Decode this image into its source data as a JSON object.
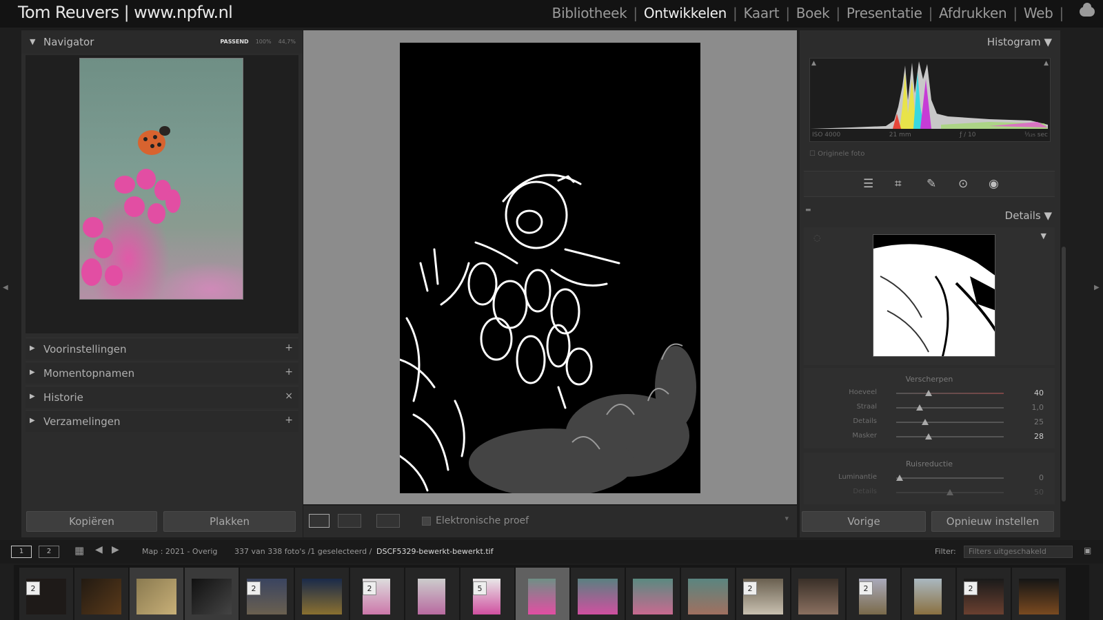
{
  "app": {
    "brand": "Tom Reuvers | www.npfw.nl",
    "modules": [
      {
        "label": "Bibliotheek",
        "active": false
      },
      {
        "label": "Ontwikkelen",
        "active": true
      },
      {
        "label": "Kaart",
        "active": false
      },
      {
        "label": "Boek",
        "active": false
      },
      {
        "label": "Presentatie",
        "active": false
      },
      {
        "label": "Afdrukken",
        "active": false
      },
      {
        "label": "Web",
        "active": false
      }
    ],
    "icons": {
      "cloud": "cloud-icon"
    }
  },
  "left": {
    "navigator_title": "Navigator",
    "zoom": {
      "fit": "PASSEND",
      "z100": "100%",
      "z447": "44,7%"
    },
    "sections": [
      {
        "label": "Voorinstellingen",
        "action": "+"
      },
      {
        "label": "Momentopnamen",
        "action": "+"
      },
      {
        "label": "Historie",
        "action": "×"
      },
      {
        "label": "Verzamelingen",
        "action": "+"
      }
    ],
    "copy_label": "Kopiëren",
    "paste_label": "Plakken"
  },
  "center": {
    "proof_label": "Elektronische proef"
  },
  "right": {
    "histogram_title": "Histogram",
    "meta": {
      "iso": "ISO 4000",
      "focal": "21 mm",
      "aperture": "ƒ / 10",
      "shutter": "¹⁄₁₂₅ sec"
    },
    "original_label": "Originele foto",
    "details_title": "Details",
    "sharpen": {
      "title": "Verscherpen",
      "rows": [
        {
          "label": "Hoeveel",
          "value": "40",
          "pos": 0.3
        },
        {
          "label": "Straal",
          "value": "1,0",
          "pos": 0.22
        },
        {
          "label": "Details",
          "value": "25",
          "pos": 0.27
        },
        {
          "label": "Masker",
          "value": "28",
          "pos": 0.3
        }
      ]
    },
    "noise": {
      "title": "Ruisreductie",
      "rows": [
        {
          "label": "Luminantie",
          "value": "0",
          "pos": 0.03
        },
        {
          "label": "Details",
          "value": "50",
          "pos": 0.5
        }
      ]
    },
    "prev_label": "Vorige",
    "reset_label": "Opnieuw instellen"
  },
  "filmstrip": {
    "page1": "1",
    "page2": "2",
    "source": "Map : 2021 - Overig",
    "count": "337 van 338 foto's /1 geselecteerd /",
    "filename": "DSCF5329-bewerkt-bewerkt.tif",
    "filter_label": "Filter:",
    "filter_value": "Filters uitgeschakeld",
    "badges": [
      "2",
      "2",
      "2",
      "5",
      "2",
      "2",
      "2"
    ]
  }
}
